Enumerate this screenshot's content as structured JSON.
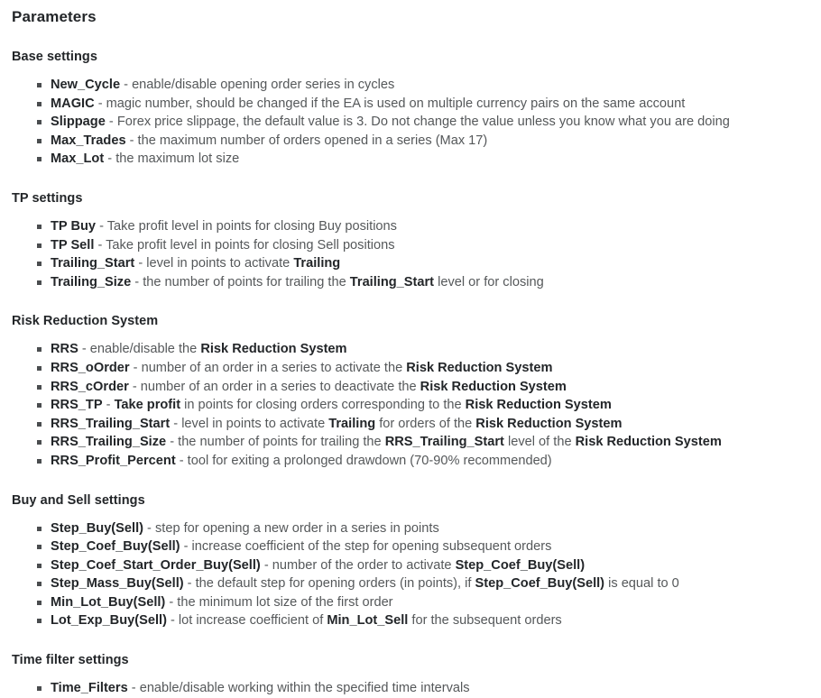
{
  "page": {
    "title": "Parameters"
  },
  "sections": [
    {
      "id": "base",
      "title": "Base settings",
      "items": [
        {
          "term": "New_Cycle",
          "sep": " - ",
          "parts": [
            {
              "text": "enable/disable opening order series in cycles",
              "bold": false
            }
          ]
        },
        {
          "term": "MAGIC",
          "sep": " - ",
          "parts": [
            {
              "text": "magic number, should be changed if the EA is used on multiple currency pairs on the same account",
              "bold": false
            }
          ]
        },
        {
          "term": "Slippage",
          "sep": " - ",
          "parts": [
            {
              "text": "Forex price slippage, the default value is 3. Do not change the value unless you know what you are doing",
              "bold": false
            }
          ]
        },
        {
          "term": "Max_Trades",
          "sep": " - ",
          "parts": [
            {
              "text": "the maximum number of orders opened in a series (Max 17)",
              "bold": false
            }
          ]
        },
        {
          "term": "Max_Lot",
          "sep": " - ",
          "parts": [
            {
              "text": "the maximum lot size",
              "bold": false
            }
          ]
        }
      ]
    },
    {
      "id": "tp",
      "title": "TP settings",
      "items": [
        {
          "term": "TP Buy",
          "sep": " - ",
          "parts": [
            {
              "text": "Take profit level in points for closing Buy positions",
              "bold": false
            }
          ]
        },
        {
          "term": "TP Sell",
          "sep": " - ",
          "parts": [
            {
              "text": "Take profit level in points for closing Sell positions",
              "bold": false
            }
          ]
        },
        {
          "term": "Trailing_Start",
          "sep": " - ",
          "parts": [
            {
              "text": "level in points to activate ",
              "bold": false
            },
            {
              "text": "Trailing",
              "bold": true
            }
          ]
        },
        {
          "term": "Trailing_Size",
          "sep": " - ",
          "parts": [
            {
              "text": "the number of points for trailing the ",
              "bold": false
            },
            {
              "text": "Trailing_Start",
              "bold": true
            },
            {
              "text": " level or for closing",
              "bold": false
            }
          ]
        }
      ]
    },
    {
      "id": "rrs",
      "title": "Risk Reduction System",
      "items": [
        {
          "term": "RRS",
          "sep": " - ",
          "parts": [
            {
              "text": "enable/disable the ",
              "bold": false
            },
            {
              "text": "Risk Reduction System",
              "bold": true
            }
          ]
        },
        {
          "term": "RRS_oOrder",
          "sep": " - ",
          "parts": [
            {
              "text": "number of an order in a series to activate the ",
              "bold": false
            },
            {
              "text": "Risk Reduction System",
              "bold": true
            }
          ]
        },
        {
          "term": "RRS_cOrder",
          "sep": " - ",
          "parts": [
            {
              "text": "number of an order in a series to deactivate the ",
              "bold": false
            },
            {
              "text": "Risk Reduction System",
              "bold": true
            }
          ]
        },
        {
          "term": "RRS_TP",
          "sep": " - ",
          "parts": [
            {
              "text": "Take profit",
              "bold": true
            },
            {
              "text": " in points for closing orders corresponding to the ",
              "bold": false
            },
            {
              "text": "Risk Reduction System",
              "bold": true
            }
          ]
        },
        {
          "term": "RRS_Trailing_Start",
          "sep": " - ",
          "parts": [
            {
              "text": "level in points to activate ",
              "bold": false
            },
            {
              "text": "Trailing",
              "bold": true
            },
            {
              "text": " for orders of the ",
              "bold": false
            },
            {
              "text": "Risk Reduction System",
              "bold": true
            }
          ]
        },
        {
          "term": "RRS_Trailing_Size",
          "sep": " - ",
          "parts": [
            {
              "text": "the number of points for trailing the ",
              "bold": false
            },
            {
              "text": "RRS_Trailing_Start",
              "bold": true
            },
            {
              "text": " level of the ",
              "bold": false
            },
            {
              "text": "Risk Reduction System",
              "bold": true
            }
          ]
        },
        {
          "term": "RRS_Profit_Percent",
          "sep": " - ",
          "parts": [
            {
              "text": "tool for exiting a prolonged drawdown (70-90% recommended)",
              "bold": false
            }
          ]
        }
      ]
    },
    {
      "id": "buysell",
      "title": "Buy and Sell settings",
      "items": [
        {
          "term": "Step_Buy(Sell)",
          "sep": " - ",
          "parts": [
            {
              "text": "step for opening a new order in a series in points",
              "bold": false
            }
          ]
        },
        {
          "term": "Step_Coef_Buy(Sell)",
          "sep": " - ",
          "parts": [
            {
              "text": "increase coefficient of the step for opening subsequent orders",
              "bold": false
            }
          ]
        },
        {
          "term": "Step_Coef_Start_Order_Buy(Sell)",
          "sep": " - ",
          "parts": [
            {
              "text": "number of the order to activate ",
              "bold": false
            },
            {
              "text": "Step_Coef_Buy(Sell)",
              "bold": true
            }
          ]
        },
        {
          "term": "Step_Mass_Buy(Sell)",
          "sep": " - ",
          "parts": [
            {
              "text": "the default step for opening orders (in points), if ",
              "bold": false
            },
            {
              "text": "Step_Coef_Buy(Sell)",
              "bold": true
            },
            {
              "text": " is equal to 0",
              "bold": false
            }
          ]
        },
        {
          "term": "Min_Lot_Buy(Sell)",
          "sep": " - ",
          "parts": [
            {
              "text": "the minimum lot size of the first order",
              "bold": false
            }
          ]
        },
        {
          "term": "Lot_Exp_Buy(Sell)",
          "sep": " - ",
          "parts": [
            {
              "text": "lot increase coefficient of ",
              "bold": false
            },
            {
              "text": "Min_Lot_Sell",
              "bold": true
            },
            {
              "text": " for the subsequent orders",
              "bold": false
            }
          ]
        }
      ]
    },
    {
      "id": "time",
      "title": "Time filter settings",
      "items": [
        {
          "term": "Time_Filters",
          "sep": " - ",
          "parts": [
            {
              "text": "enable/disable working within the specified time intervals",
              "bold": false
            }
          ]
        }
      ]
    }
  ]
}
